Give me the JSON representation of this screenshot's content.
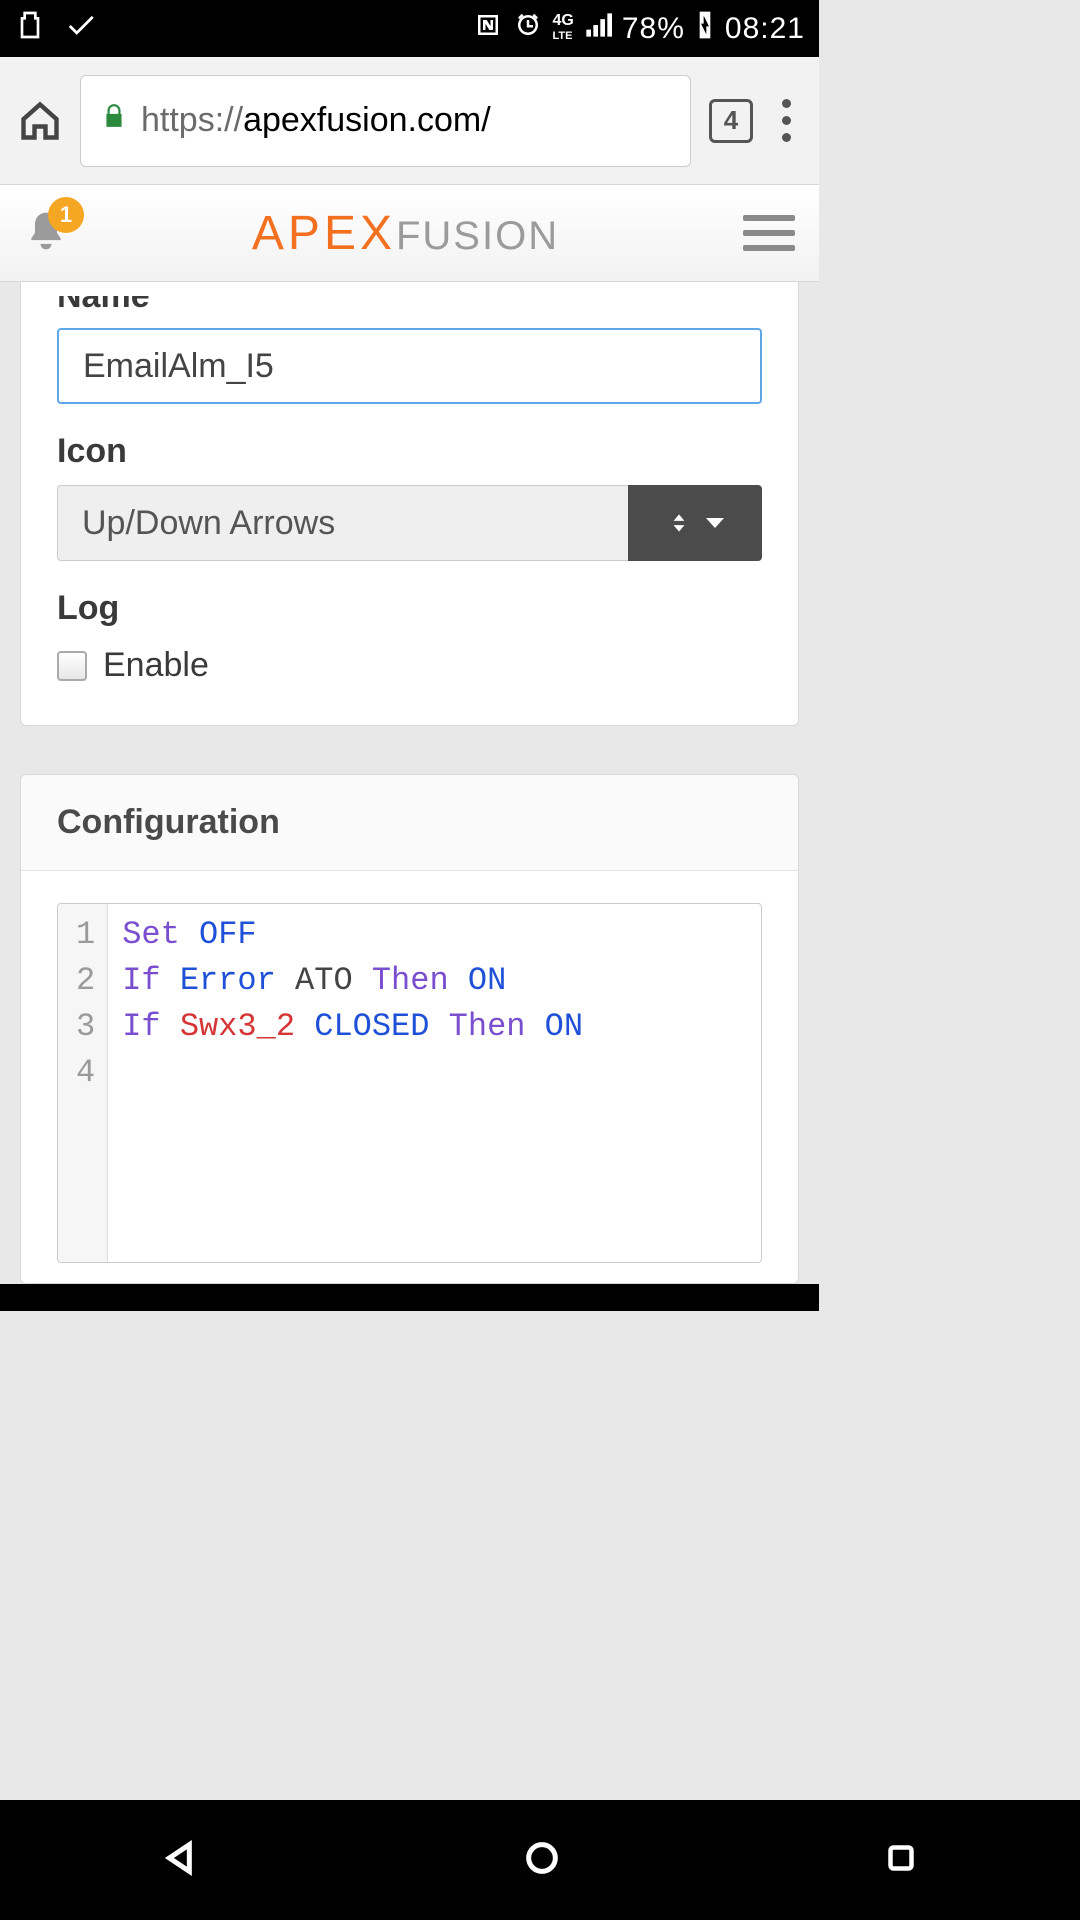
{
  "status_bar": {
    "battery_pct": "78%",
    "clock": "08:21"
  },
  "browser": {
    "url_protocol": "https://",
    "url_host": "apexfusion.com/",
    "tab_count": "4"
  },
  "app_header": {
    "notif_count": "1",
    "logo_main": "APEX",
    "logo_sub": "FUSION"
  },
  "form": {
    "name_label_cut": "",
    "name_value": "EmailAlm_I5",
    "icon_label": "Icon",
    "icon_selected": "Up/Down Arrows",
    "log_label": "Log",
    "log_enable_label": "Enable",
    "log_enable_checked": false
  },
  "config": {
    "header": "Configuration",
    "lines": [
      {
        "n": "1",
        "tokens": [
          {
            "t": "Set",
            "c": "kw"
          },
          {
            "t": " "
          },
          {
            "t": "OFF",
            "c": "blue"
          }
        ]
      },
      {
        "n": "2",
        "tokens": [
          {
            "t": "If",
            "c": "kw"
          },
          {
            "t": " "
          },
          {
            "t": "Error",
            "c": "blue"
          },
          {
            "t": " "
          },
          {
            "t": "ATO",
            "c": "plain"
          },
          {
            "t": " "
          },
          {
            "t": "Then",
            "c": "kw"
          },
          {
            "t": " "
          },
          {
            "t": "ON",
            "c": "blue"
          }
        ]
      },
      {
        "n": "3",
        "tokens": [
          {
            "t": "If",
            "c": "kw"
          },
          {
            "t": " "
          },
          {
            "t": "Swx3_2",
            "c": "red"
          },
          {
            "t": " "
          },
          {
            "t": "CLOSED",
            "c": "blue"
          },
          {
            "t": " "
          },
          {
            "t": "Then",
            "c": "kw"
          },
          {
            "t": " "
          },
          {
            "t": "ON",
            "c": "blue"
          }
        ]
      },
      {
        "n": "4",
        "tokens": []
      }
    ]
  }
}
